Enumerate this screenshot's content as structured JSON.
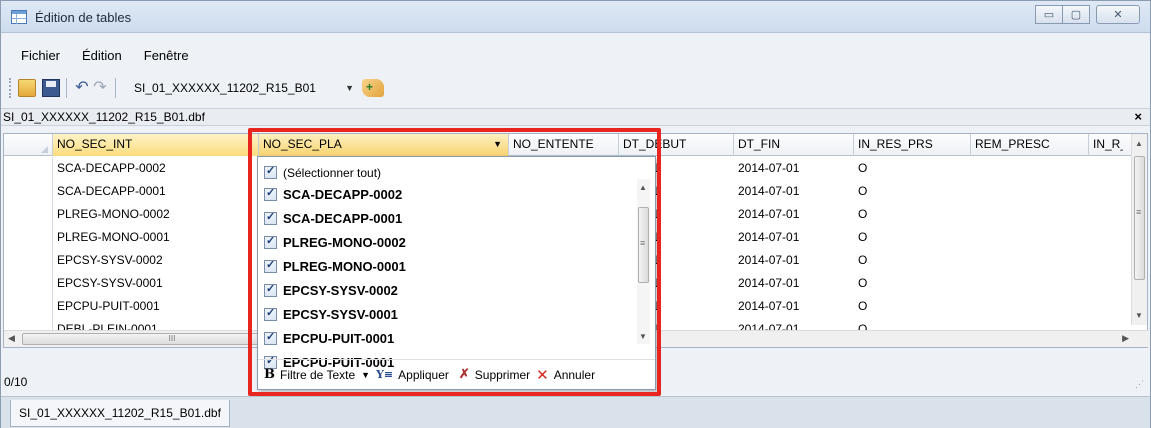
{
  "window": {
    "title": "Édition de tables",
    "buttons": [
      "▭",
      "▢",
      "✕"
    ]
  },
  "menu": {
    "items": [
      "Fichier",
      "Édition",
      "Fenêtre"
    ]
  },
  "toolbar": {
    "table_name": "SI_01_XXXXXX_11202_R15_B01"
  },
  "document": {
    "tab_label": "SI_01_XXXXXX_11202_R15_B01.dbf",
    "close_symbol": "×"
  },
  "grid": {
    "columns": [
      "NO_SEC_INT",
      "NO_SEC_PLA",
      "NO_ENTENTE",
      "DT_DEBUT",
      "DT_FIN",
      "IN_RES_PRS",
      "REM_PRESC",
      "IN_R_"
    ],
    "rows": [
      {
        "no_sec_int": "SCA-DECAPP-0002",
        "dt_debut": "5-01",
        "dt_fin": "2014-07-01",
        "in_res_prs": "O"
      },
      {
        "no_sec_int": "SCA-DECAPP-0001",
        "dt_debut": "5-01",
        "dt_fin": "2014-07-01",
        "in_res_prs": "O"
      },
      {
        "no_sec_int": "PLREG-MONO-0002",
        "dt_debut": "5-01",
        "dt_fin": "2014-07-01",
        "in_res_prs": "O"
      },
      {
        "no_sec_int": "PLREG-MONO-0001",
        "dt_debut": "5-01",
        "dt_fin": "2014-07-01",
        "in_res_prs": "O"
      },
      {
        "no_sec_int": "EPCSY-SYSV-0002",
        "dt_debut": "5-01",
        "dt_fin": "2014-07-01",
        "in_res_prs": "O"
      },
      {
        "no_sec_int": "EPCSY-SYSV-0001",
        "dt_debut": "5-01",
        "dt_fin": "2014-07-01",
        "in_res_prs": "O"
      },
      {
        "no_sec_int": "EPCPU-PUIT-0001",
        "dt_debut": "5-01",
        "dt_fin": "2014-07-01",
        "in_res_prs": "O"
      },
      {
        "no_sec_int": "DEBL-PLEIN-0001",
        "dt_debut": "5-01",
        "dt_fin": "2014-07-01",
        "in_res_prs": "O"
      }
    ]
  },
  "status": {
    "record_count": "0/10"
  },
  "bottom_tab": {
    "label": "SI_01_XXXXXX_11202_R15_B01.dbf"
  },
  "filter_popup": {
    "select_all": "(Sélectionner tout)",
    "items": [
      "SCA-DECAPP-0002",
      "SCA-DECAPP-0001",
      "PLREG-MONO-0002",
      "PLREG-MONO-0001",
      "EPCSY-SYSV-0002",
      "EPCSY-SYSV-0001",
      "EPCPU-PUIT-0001"
    ],
    "partial_item": "EPCPU-PUIT-0001",
    "footer": {
      "text_filter_icon": "B",
      "text_filter": "Filtre de Texte",
      "apply": "Appliquer",
      "remove": "Supprimer",
      "cancel": "Annuler"
    }
  },
  "highlight_color": "#e8251f"
}
